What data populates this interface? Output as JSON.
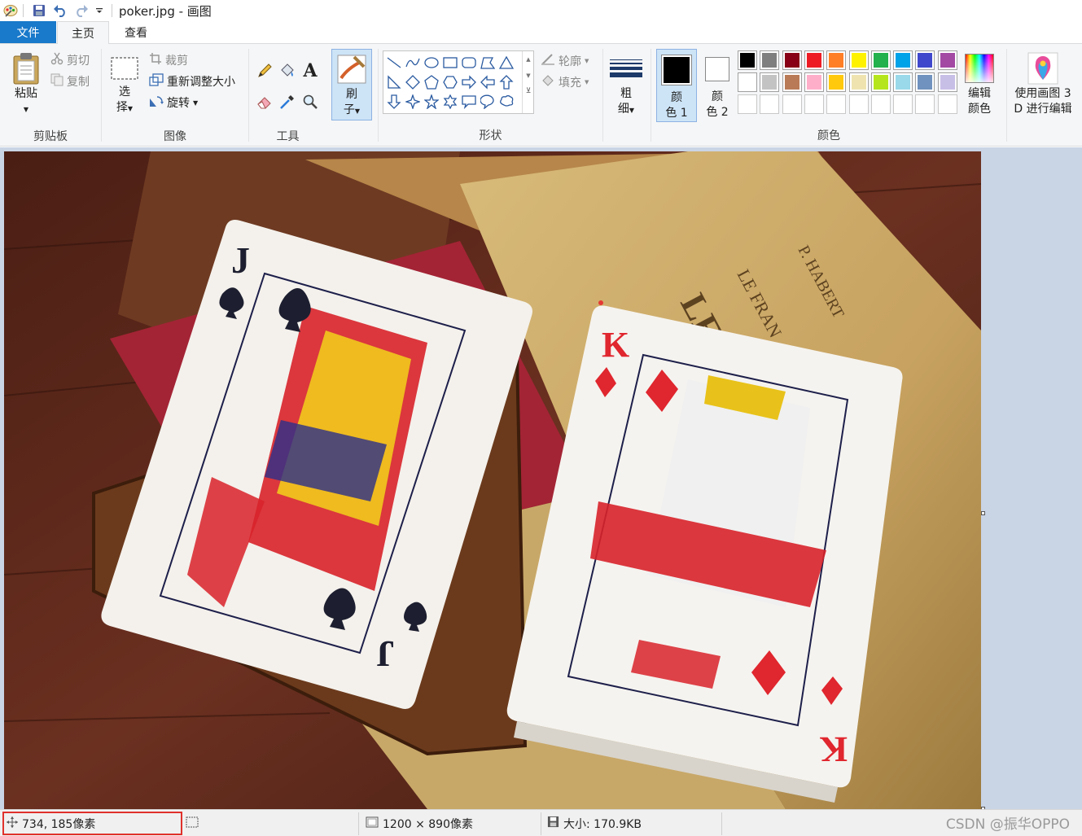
{
  "window": {
    "title": "poker.jpg - 画图"
  },
  "tabs": {
    "file": "文件",
    "home": "主页",
    "view": "查看"
  },
  "clipboard": {
    "paste": "粘贴",
    "cut": "剪切",
    "copy": "复制",
    "label": "剪贴板"
  },
  "image": {
    "select_line1": "选",
    "select_line2": "择",
    "crop": "裁剪",
    "resize": "重新调整大小",
    "rotate": "旋转",
    "label": "图像"
  },
  "tools": {
    "label": "工具",
    "text_glyph": "A"
  },
  "brush": {
    "line1": "刷",
    "line2": "子"
  },
  "shapes": {
    "outline": "轮廓",
    "fill": "填充",
    "label": "形状"
  },
  "size": {
    "line1": "粗",
    "line2": "细"
  },
  "colors": {
    "color1_line1": "颜",
    "color1_line2": "色 1",
    "color2_line1": "颜",
    "color2_line2": "色 2",
    "edit_line1": "编辑",
    "edit_line2": "颜色",
    "label": "颜色",
    "color1_value": "#000000",
    "color2_value": "#ffffff",
    "palette_row1": [
      "#000000",
      "#7f7f7f",
      "#880015",
      "#ed1c24",
      "#ff7f27",
      "#fff200",
      "#22b14c",
      "#00a2e8",
      "#3f48cc",
      "#a349a4"
    ],
    "palette_row2": [
      "#ffffff",
      "#c3c3c3",
      "#b97a57",
      "#ffaec9",
      "#ffc90e",
      "#efe4b0",
      "#b5e61d",
      "#99d9ea",
      "#7092be",
      "#c8bfe7"
    ]
  },
  "paint3d": {
    "line1": "使用画图 3",
    "line2": "D 进行编辑"
  },
  "status": {
    "cursor": "734, 185像素",
    "dimensions": "1200 × 890像素",
    "filesize": "大小: 170.9KB"
  },
  "watermark": "CSDN @振华OPPO",
  "cards": {
    "left_rank": "J",
    "right_rank": "K"
  },
  "book": {
    "text1": "LECT",
    "text2": "LE FRAN",
    "text3": "P. HABERT"
  }
}
